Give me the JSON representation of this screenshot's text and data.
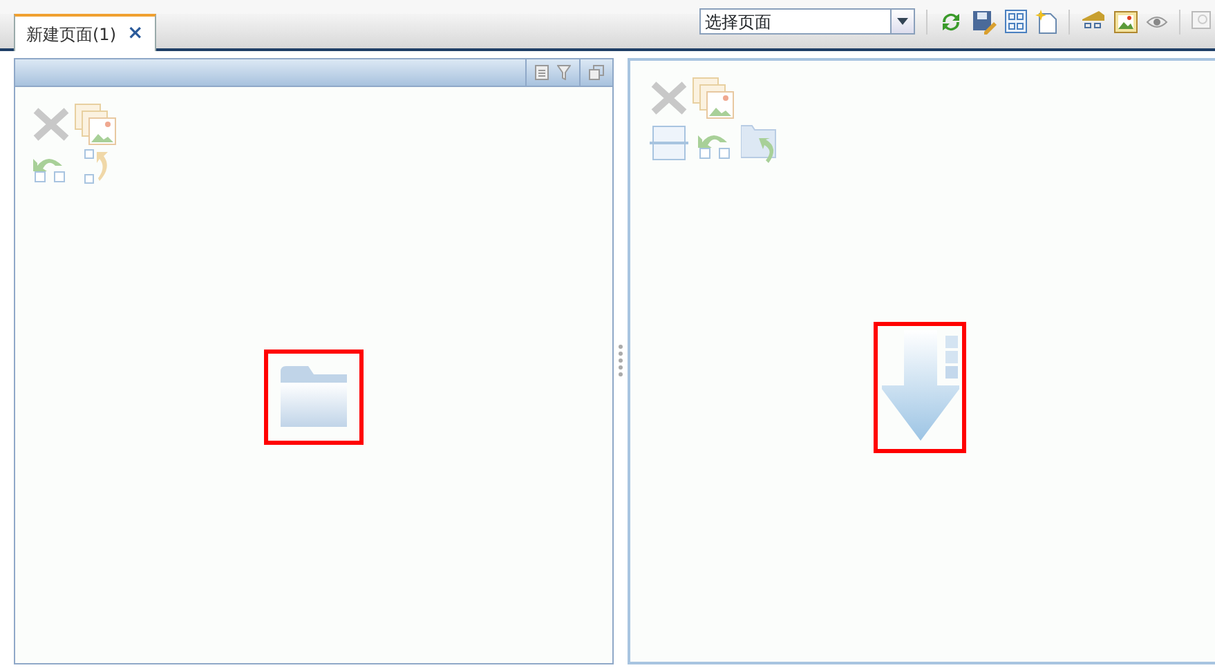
{
  "tabs": [
    {
      "label": "新建页面(1)",
      "close": "×",
      "selected": true
    }
  ],
  "toolbar": {
    "page_select": {
      "value": "选择页面"
    }
  }
}
